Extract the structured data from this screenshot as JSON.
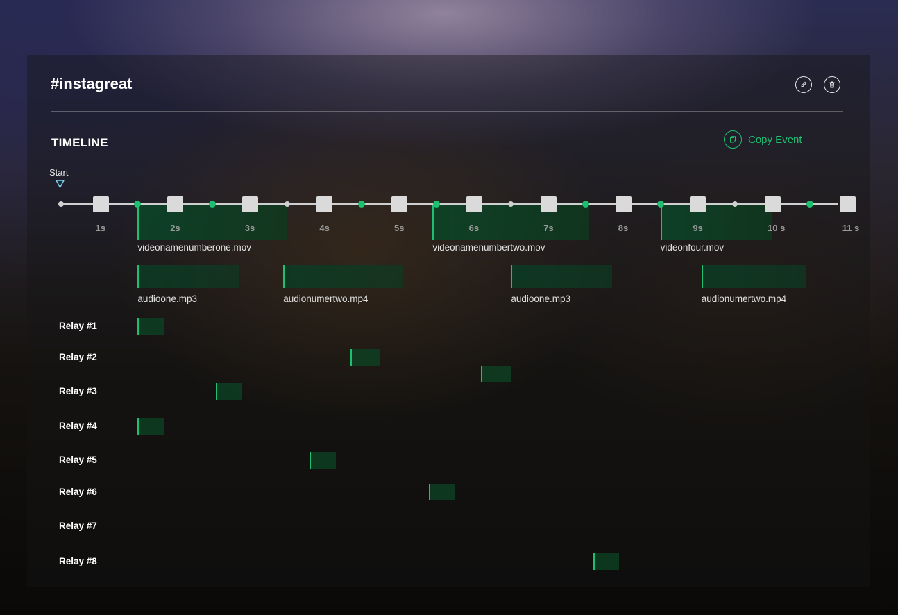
{
  "header": {
    "title": "#instagreat",
    "edit_icon": "pencil-icon",
    "delete_icon": "trash-icon"
  },
  "timeline": {
    "section_title": "TIMELINE",
    "copy_button_label": "Copy Event",
    "copy_icon": "copy-icon",
    "start_label": "Start",
    "ticks": [
      "1s",
      "2s",
      "3s",
      "4s",
      "5s",
      "6s",
      "7s",
      "8s",
      "9s",
      "10 s",
      "11 s"
    ],
    "video_clips": [
      {
        "name": "videonamenumberone.mov",
        "start_s": 1.5,
        "end_s": 3.5
      },
      {
        "name": "videonamenumbertwo.mov",
        "start_s": 5.45,
        "end_s": 7.55
      },
      {
        "name": "videonfour.mov",
        "start_s": 8.5,
        "end_s": 10.0
      }
    ],
    "audio_clips": [
      {
        "name": "audioone.mp3",
        "start_s": 1.5,
        "end_s": 2.85
      },
      {
        "name": "audionumertwo.mp4",
        "start_s": 3.45,
        "end_s": 5.05
      },
      {
        "name": "audioone.mp3",
        "start_s": 6.5,
        "end_s": 7.85
      },
      {
        "name": "audionumertwo.mp4",
        "start_s": 9.05,
        "end_s": 10.45
      }
    ],
    "relays": [
      {
        "label": "Relay #1",
        "events": [
          {
            "start_s": 1.5,
            "end_s": 1.85
          }
        ]
      },
      {
        "label": "Relay #2",
        "events": [
          {
            "start_s": 4.35,
            "end_s": 4.75
          },
          {
            "start_s": 6.1,
            "end_s": 6.5
          }
        ]
      },
      {
        "label": "Relay #3",
        "events": [
          {
            "start_s": 2.55,
            "end_s": 2.9
          }
        ]
      },
      {
        "label": "Relay #4",
        "events": [
          {
            "start_s": 1.5,
            "end_s": 1.85
          }
        ]
      },
      {
        "label": "Relay #5",
        "events": [
          {
            "start_s": 3.8,
            "end_s": 4.15
          }
        ]
      },
      {
        "label": "Relay #6",
        "events": [
          {
            "start_s": 5.4,
            "end_s": 5.75
          }
        ]
      },
      {
        "label": "Relay #7",
        "events": []
      },
      {
        "label": "Relay #8",
        "events": [
          {
            "start_s": 7.6,
            "end_s": 7.95
          }
        ]
      }
    ],
    "colors": {
      "accent": "#1fbf72",
      "marker": "#dadada",
      "block": "#0c4a28"
    }
  }
}
